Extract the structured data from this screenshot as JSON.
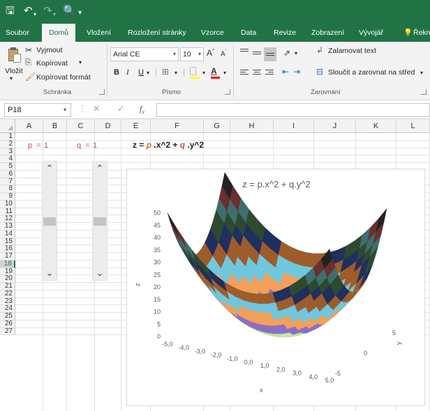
{
  "title_bar": {
    "qa_save_icon": "save-icon",
    "qa_undo_icon": "undo-icon",
    "qa_redo_icon": "redo-icon",
    "qa_preview_icon": "print-preview-icon"
  },
  "ribbon_tabs": [
    "Soubor",
    "Domů",
    "Vložení",
    "Rozložení stránky",
    "Vzorce",
    "Data",
    "Revize",
    "Zobrazení",
    "Vývojář",
    "Řekn"
  ],
  "active_tab": "Domů",
  "tell_me_icon": "lightbulb-icon",
  "clipboard": {
    "paste": "Vložit",
    "cut": "Vyjmout",
    "copy": "Kopírovat",
    "format_painter": "Kopírovat formát",
    "group_label": "Schránka"
  },
  "font": {
    "name": "Arial CE",
    "size": "10",
    "bold": "B",
    "italic": "I",
    "underline": "U",
    "group_label": "Písmo"
  },
  "alignment": {
    "wrap_text": "Zalamovat text",
    "merge_center": "Sloučit a zarovnat na střed",
    "group_label": "Zarovnání"
  },
  "formula_bar": {
    "name_box": "P18",
    "formula": ""
  },
  "columns": [
    "A",
    "B",
    "C",
    "D",
    "E",
    "F",
    "G",
    "H",
    "I",
    "J",
    "K",
    "L"
  ],
  "rows": [
    "1",
    "2",
    "3",
    "4",
    "5",
    "6",
    "7",
    "8",
    "9",
    "10",
    "11",
    "12",
    "13",
    "14",
    "15",
    "16",
    "17",
    "18",
    "19",
    "20",
    "21",
    "22",
    "23",
    "24",
    "25",
    "26",
    "27"
  ],
  "selected_row": "18",
  "cells": {
    "p_label": "p",
    "p_eq": "=",
    "p_value": "1",
    "q_label": "q",
    "q_eq": "=",
    "q_value": "1",
    "formula_z": "z = ",
    "formula_p": "p",
    "formula_mid": " .x^2 + ",
    "formula_q": "q",
    "formula_end": " .y^2"
  },
  "scrollbars": {
    "p_position": 0.5,
    "q_position": 0.5
  },
  "colors": {
    "excel_green": "#217346",
    "param_red": "#c0504d",
    "param_orange": "#e46c0a"
  },
  "chart_data": {
    "type": "surface",
    "title": "z = p.x^2 + q.y^2",
    "xlabel": "x",
    "ylabel": "y",
    "zlabel": "z",
    "z_ticks": [
      "0",
      "5",
      "10",
      "15",
      "20",
      "25",
      "30",
      "35",
      "40",
      "45",
      "50"
    ],
    "x_ticks": [
      "-5,0",
      "-4,0",
      "-3,0",
      "-2,0",
      "-1,0",
      "0,0",
      "1,0",
      "2,0",
      "3,0",
      "4,0",
      "5,0"
    ],
    "y_ticks": [
      "-5",
      "0",
      "5"
    ],
    "x_range": [
      -5,
      5
    ],
    "y_range": [
      -5,
      5
    ],
    "zlim": [
      0,
      50
    ],
    "p": 1,
    "q": 1,
    "band_colors": [
      "#c3e6a0",
      "#8a6fc4",
      "#f2a05a",
      "#6fc7de",
      "#9f5c2b",
      "#1f2f5e",
      "#2e4a2e",
      "#3d6f6f",
      "#6b2f2f",
      "#232323"
    ]
  }
}
